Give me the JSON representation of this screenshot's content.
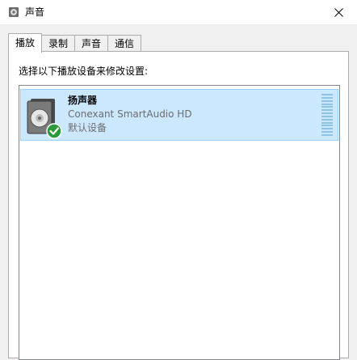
{
  "window": {
    "title": "声音",
    "icon": "speaker-icon"
  },
  "tabs": [
    {
      "label": "播放",
      "active": true
    },
    {
      "label": "录制",
      "active": false
    },
    {
      "label": "声音",
      "active": false
    },
    {
      "label": "通信",
      "active": false
    }
  ],
  "playback": {
    "instruction": "选择以下播放设备来修改设置:",
    "devices": [
      {
        "name": "扬声器",
        "description": "Conexant SmartAudio HD",
        "status": "默认设备",
        "icon": "speaker-icon",
        "badge": "check-icon"
      }
    ]
  },
  "colors": {
    "selection_bg": "#cce8ff",
    "selection_border": "#99d1ff",
    "default_badge": "#2a9a3a"
  }
}
